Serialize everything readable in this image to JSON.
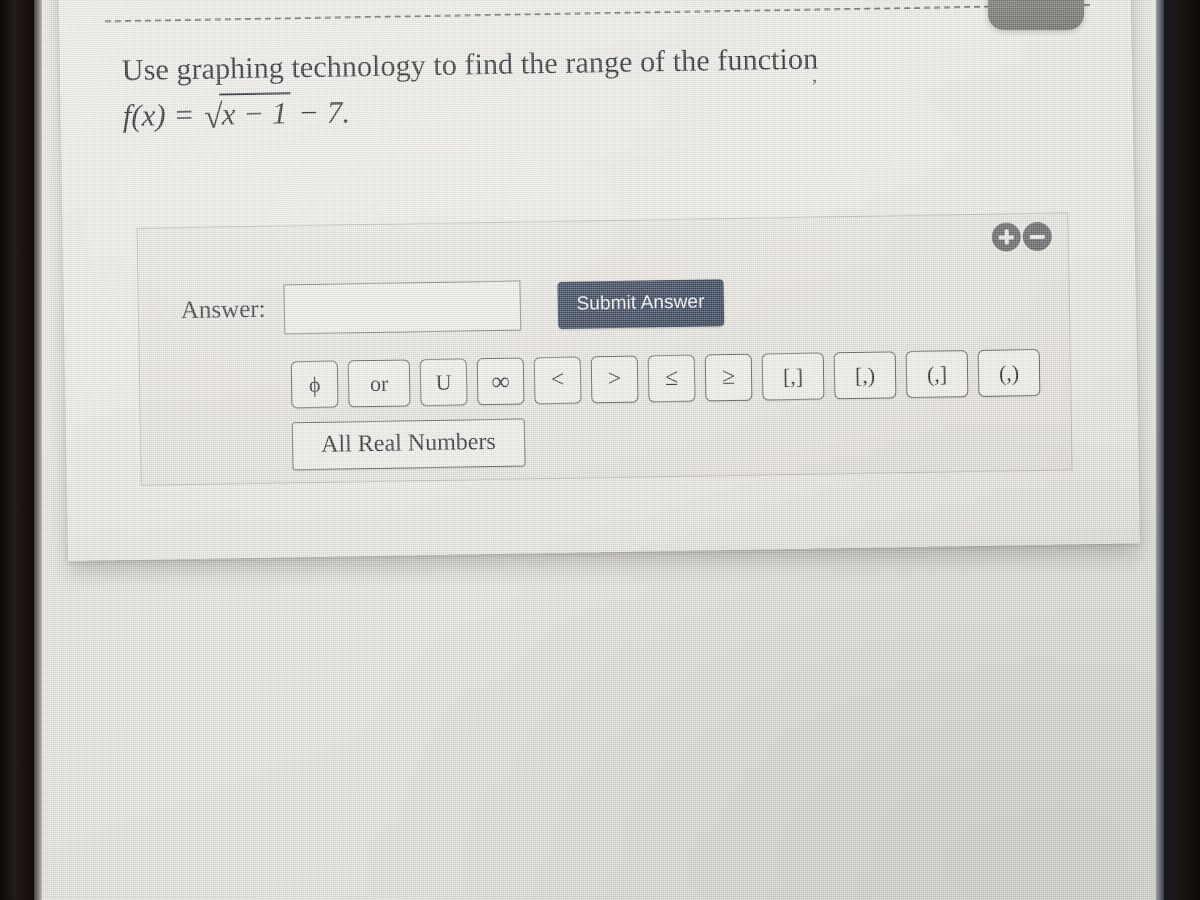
{
  "question": {
    "prompt": "Use graphing technology to find the range of the function",
    "function_label": "f(x)",
    "equals": "=",
    "radical_sign": "√",
    "radicand": "x − 1",
    "tail": "− 7.",
    "stray_mark": ","
  },
  "answer_panel": {
    "label": "Answer:",
    "input_value": "",
    "input_placeholder": "",
    "submit_label": "Submit Answer",
    "zoom_in_label": "+",
    "zoom_out_label": "−",
    "keys": [
      {
        "name": "empty-set",
        "label": "ϕ",
        "class": ""
      },
      {
        "name": "or",
        "label": "or",
        "class": "wide"
      },
      {
        "name": "union",
        "label": "U",
        "class": ""
      },
      {
        "name": "infinity",
        "label": "∞",
        "class": "inf"
      },
      {
        "name": "less-than",
        "label": "<",
        "class": "rel"
      },
      {
        "name": "greater-than",
        "label": ">",
        "class": "rel"
      },
      {
        "name": "less-than-or-equal",
        "label": "≤",
        "class": "rel"
      },
      {
        "name": "greater-than-or-equal",
        "label": "≥",
        "class": "rel"
      },
      {
        "name": "closed-interval",
        "label": "[,]",
        "class": "wide"
      },
      {
        "name": "left-closed-interval",
        "label": "[,)",
        "class": "wide"
      },
      {
        "name": "right-closed-interval",
        "label": "(,]",
        "class": "wide"
      },
      {
        "name": "open-interval",
        "label": "(,)",
        "class": "wide"
      }
    ],
    "all_real_numbers_label": "All Real Numbers"
  },
  "colors": {
    "submit_button": "#17263e",
    "panel_background": "#e6e4de",
    "card_background": "#eeece6",
    "key_background": "#edebe6",
    "zoom_button": "#5b5b5b",
    "text": "#14171c"
  }
}
